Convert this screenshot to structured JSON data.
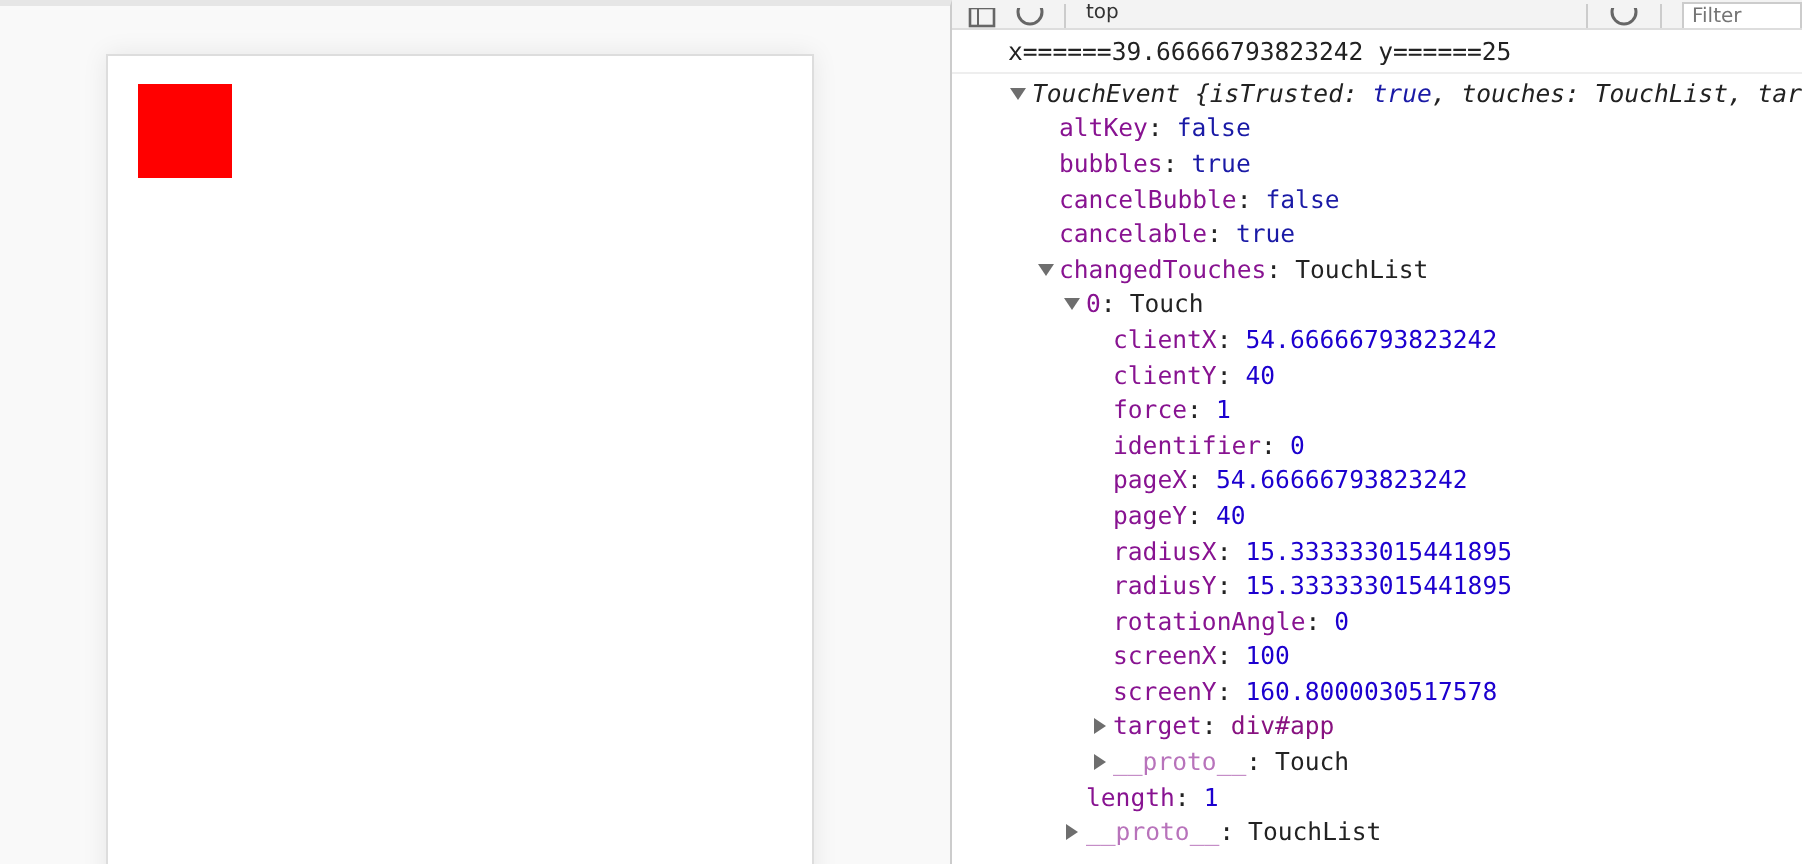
{
  "toolbar": {
    "context": "top",
    "filter": {
      "placeholder": "Filter"
    }
  },
  "console": {
    "log": "x======39.66666793823242 y======25",
    "tree": [
      {
        "key": "TouchEvent",
        "expanded": true,
        "preview": [
          {
            "text": "{isTrusted: ",
            "kind": "plain"
          },
          {
            "text": "true",
            "kind": "keyword"
          },
          {
            "text": ", touches: TouchList, tar",
            "kind": "plain"
          }
        ],
        "children": [
          {
            "key": "altKey",
            "colon": ":",
            "value": "false",
            "kind": "keyword"
          },
          {
            "key": "bubbles",
            "colon": ":",
            "value": "true",
            "kind": "keyword"
          },
          {
            "key": "cancelBubble",
            "colon": ":",
            "value": "false",
            "kind": "keyword"
          },
          {
            "key": "cancelable",
            "colon": ":",
            "value": "true",
            "kind": "keyword"
          },
          {
            "key": "changedTouches",
            "colon": ":",
            "value": "TouchList",
            "kind": "object",
            "expanded": true,
            "children": [
              {
                "key": "0",
                "colon": ":",
                "value": "Touch",
                "kind": "object",
                "expanded": true,
                "children": [
                  {
                    "key": "clientX",
                    "colon": ":",
                    "value": "54.66666793823242",
                    "kind": "number"
                  },
                  {
                    "key": "clientY",
                    "colon": ":",
                    "value": "40",
                    "kind": "number"
                  },
                  {
                    "key": "force",
                    "colon": ":",
                    "value": "1",
                    "kind": "number"
                  },
                  {
                    "key": "identifier",
                    "colon": ":",
                    "value": "0",
                    "kind": "number"
                  },
                  {
                    "key": "pageX",
                    "colon": ":",
                    "value": "54.66666793823242",
                    "kind": "number"
                  },
                  {
                    "key": "pageY",
                    "colon": ":",
                    "value": "40",
                    "kind": "number"
                  },
                  {
                    "key": "radiusX",
                    "colon": ":",
                    "value": "15.333333015441895",
                    "kind": "number"
                  },
                  {
                    "key": "radiusY",
                    "colon": ":",
                    "value": "15.333333015441895",
                    "kind": "number"
                  },
                  {
                    "key": "rotationAngle",
                    "colon": ":",
                    "value": "0",
                    "kind": "number"
                  },
                  {
                    "key": "screenX",
                    "colon": ":",
                    "value": "100",
                    "kind": "number"
                  },
                  {
                    "key": "screenY",
                    "colon": ":",
                    "value": "160.8000030517578",
                    "kind": "number"
                  },
                  {
                    "key": "target",
                    "colon": ":",
                    "value": "div#app",
                    "kind": "node",
                    "expanded": false
                  },
                  {
                    "key": "__proto__",
                    "colon": ":",
                    "value": "Touch",
                    "kind": "object",
                    "expanded": false,
                    "proto": true
                  }
                ]
              },
              {
                "key": "length",
                "colon": ":",
                "value": "1",
                "kind": "number"
              },
              {
                "key": "__proto__",
                "colon": ":",
                "value": "TouchList",
                "kind": "object",
                "expanded": false,
                "proto": true
              }
            ]
          }
        ]
      }
    ]
  }
}
